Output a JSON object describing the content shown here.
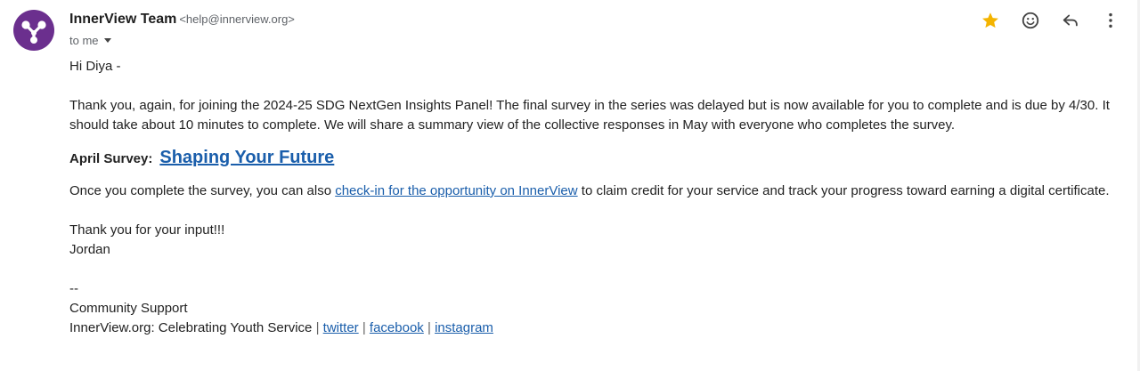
{
  "header": {
    "sender_name": "InnerView Team",
    "sender_email": "<help@innerview.org>",
    "to_label": "to me"
  },
  "icons": {
    "avatar": "innerview-logo-icon",
    "star": "star-icon",
    "emoji": "emoji-icon",
    "reply": "reply-icon",
    "more": "more-vert-icon"
  },
  "colors": {
    "avatar_bg": "#6b2f8e",
    "star": "#f4b400",
    "link": "#1a5eab"
  },
  "message": {
    "greeting": "Hi Diya -",
    "intro": "Thank you, again, for joining the 2024-25 SDG NextGen Insights Panel! The final survey in the series was delayed but is now available for you to complete and is due by 4/30. It should take about 10 minutes to complete. We will share a summary view of the collective responses in May with everyone who completes the survey.",
    "survey_label": "April Survey:",
    "survey_link": "Shaping Your Future",
    "checkin_before": "Once you complete the survey, you can also ",
    "checkin_link": "check-in for the opportunity on InnerView",
    "checkin_after": " to claim credit for your service and track your progress toward earning a digital certificate.",
    "thanks": "Thank you for your input!!!",
    "sign_name": "Jordan",
    "sig_dashes": "--",
    "sig_title": "Community Support",
    "sig_org": "InnerView.org: Celebrating Youth Service",
    "sig_sep": "|",
    "link_twitter": "twitter",
    "link_facebook": "facebook",
    "link_instagram": "instagram"
  }
}
